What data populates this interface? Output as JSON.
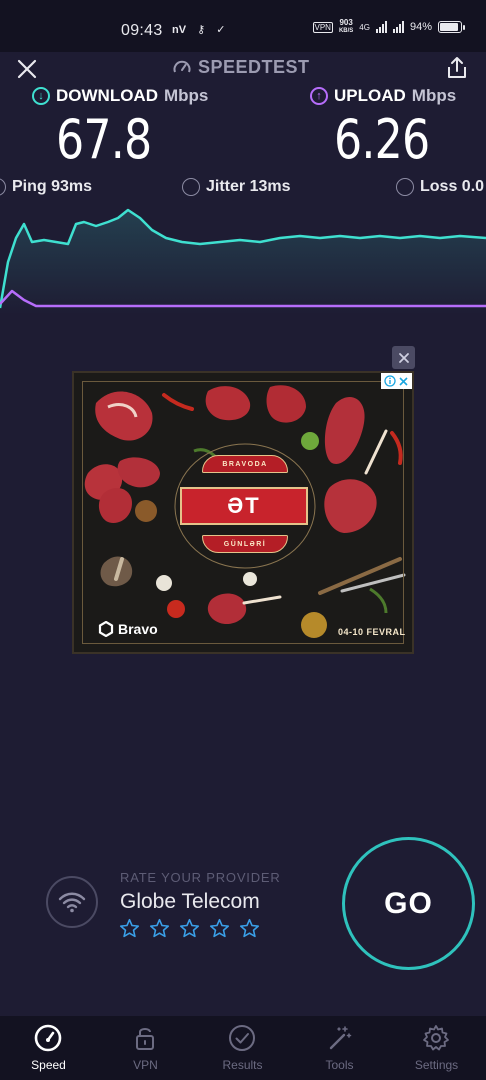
{
  "status_bar": {
    "time": "09:43",
    "left_icons": [
      "nV",
      "key-icon",
      "check-icon"
    ],
    "net_speed_value": "903",
    "net_speed_unit": "KB/S",
    "network_type": "4G",
    "battery_percent": "94%",
    "battery_level": 0.94
  },
  "header": {
    "title": "SPEEDTEST"
  },
  "metrics": {
    "download": {
      "label": "DOWNLOAD",
      "unit": "Mbps",
      "value": "67.8",
      "color": "#3fe0d0"
    },
    "upload": {
      "label": "UPLOAD",
      "unit": "Mbps",
      "value": "6.26",
      "color": "#b66dfa"
    }
  },
  "stats": {
    "ping": "Ping 93ms",
    "jitter": "Jitter 13ms",
    "loss": "Loss 0.0"
  },
  "ad": {
    "top_arc_text": "BRAVODA",
    "banner_text": "ƏT",
    "bottom_arc_text": "GÜNLƏRİ",
    "brand": "Bravo",
    "dates": "04-10 FEVRAL",
    "adchoices_icons": [
      "info-icon",
      "close-icon"
    ]
  },
  "provider": {
    "rate_label": "RATE YOUR PROVIDER",
    "name": "Globe Telecom",
    "stars_total": 5,
    "stars_rated": 0
  },
  "go_button": {
    "label": "GO",
    "ring_color": "#2fc2bd"
  },
  "nav": {
    "items": [
      {
        "label": "Speed",
        "icon": "speedometer-icon",
        "active": true
      },
      {
        "label": "VPN",
        "icon": "lock-icon",
        "active": false
      },
      {
        "label": "Results",
        "icon": "check-circle-icon",
        "active": false
      },
      {
        "label": "Tools",
        "icon": "magic-wand-icon",
        "active": false
      },
      {
        "label": "Settings",
        "icon": "gear-icon",
        "active": false
      }
    ]
  },
  "colors": {
    "background": "#1e1c33",
    "bars": "#131221",
    "download_line": "#3fe0d0",
    "upload_line": "#b66dfa"
  }
}
